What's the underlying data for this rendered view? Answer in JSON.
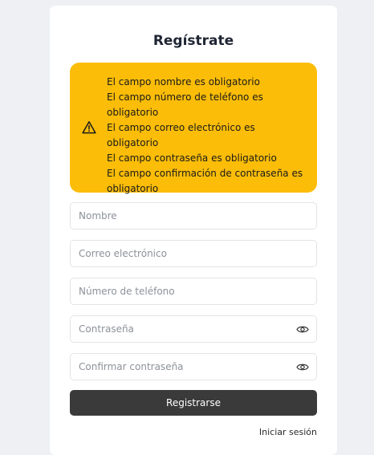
{
  "form": {
    "title": "Regístrate",
    "errors": [
      "El campo nombre es obligatorio",
      "El campo número de teléfono es obligatorio",
      "El campo correo electrónico es obligatorio",
      "El campo contraseña es obligatorio",
      "El campo confirmación de contraseña es obligatorio"
    ],
    "fields": {
      "name": {
        "placeholder": "Nombre",
        "value": ""
      },
      "email": {
        "placeholder": "Correo electrónico",
        "value": ""
      },
      "phone": {
        "placeholder": "Número de teléfono",
        "value": ""
      },
      "password": {
        "placeholder": "Contraseña",
        "value": ""
      },
      "confirm_password": {
        "placeholder": "Confirmar contraseña",
        "value": ""
      }
    },
    "submit_label": "Registrarse",
    "login_link": "Iniciar sesión"
  },
  "icons": {
    "alert": "warning-triangle-icon",
    "password_toggle": "eye-icon"
  },
  "colors": {
    "alert_bg": "#fbbd08",
    "submit_bg": "#3a3a3a",
    "page_bg": "#eef0f3"
  }
}
